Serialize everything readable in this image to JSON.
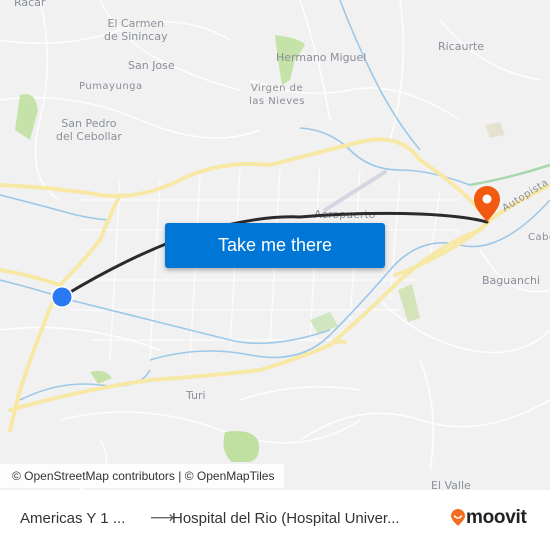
{
  "map": {
    "places": [
      {
        "name": "racar",
        "label": "Racar"
      },
      {
        "name": "el-carmen-de-sinincay",
        "label": "El Carmen\nde Sinincay"
      },
      {
        "name": "san-jose",
        "label": "San Jose"
      },
      {
        "name": "pumayunga",
        "label": "Pumayunga"
      },
      {
        "name": "san-pedro-del-cebollar",
        "label": "San Pedro\ndel Cebollar"
      },
      {
        "name": "hermano-miguel",
        "label": "Hermano Miguel"
      },
      {
        "name": "virgen-de-las-nieves",
        "label": "Virgen de\nlas Nieves"
      },
      {
        "name": "ricaurte",
        "label": "Ricaurte"
      },
      {
        "name": "aeropuerto",
        "label": "Aeropuerto"
      },
      {
        "name": "autopista",
        "label": "Autopista C"
      },
      {
        "name": "cabo",
        "label": "Cabo"
      },
      {
        "name": "baguanchi",
        "label": "Baguanchi"
      },
      {
        "name": "turi",
        "label": "Turi"
      },
      {
        "name": "el-valle",
        "label": "El Valle"
      }
    ],
    "attribution": "© OpenStreetMap contributors | © OpenMapTiles",
    "colors": {
      "origin": "#2979f2",
      "destination": "#f25a12",
      "route": "#2b2b2b",
      "highway": "#f8e8a6",
      "river": "#9cc8e8",
      "park": "#c5e3a8"
    }
  },
  "cta": {
    "label": "Take me there"
  },
  "footer": {
    "from": "Americas Y 1 ...",
    "arrow": "⟶",
    "to": "Hospital del Rio (Hospital Univer...",
    "brand": "moovit",
    "brand_color": "#f26e21"
  }
}
